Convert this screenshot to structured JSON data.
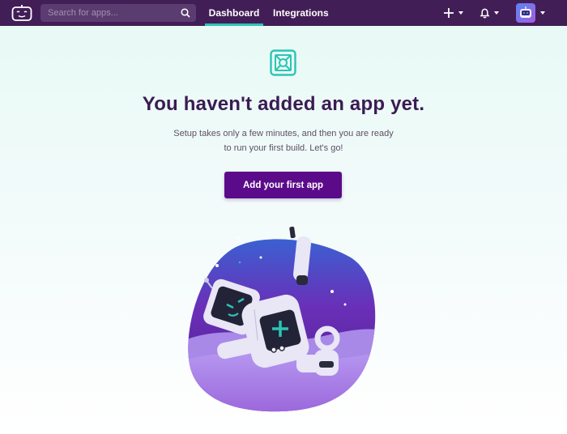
{
  "topbar": {
    "search": {
      "placeholder": "Search for apps...",
      "value": ""
    },
    "tabs": [
      {
        "label": "Dashboard",
        "active": true
      },
      {
        "label": "Integrations",
        "active": false
      }
    ],
    "icons": {
      "logo": "bitrise-bot-logo",
      "search": "search-icon",
      "add": "plus-icon",
      "notifications": "bell-icon",
      "avatar": "user-avatar"
    }
  },
  "main": {
    "icon": "empty-apps-icon",
    "headline": "You haven't added an app yet.",
    "subtext_line1": "Setup takes only a few minutes, and then you are ready",
    "subtext_line2": "to run your first build. Let's go!",
    "cta_label": "Add your first app",
    "illustration": "robot-illustration"
  },
  "colors": {
    "topbar": "#421e57",
    "accent": "#2bc5b4",
    "cta": "#5b0b8a",
    "headline": "#3b1b52"
  }
}
